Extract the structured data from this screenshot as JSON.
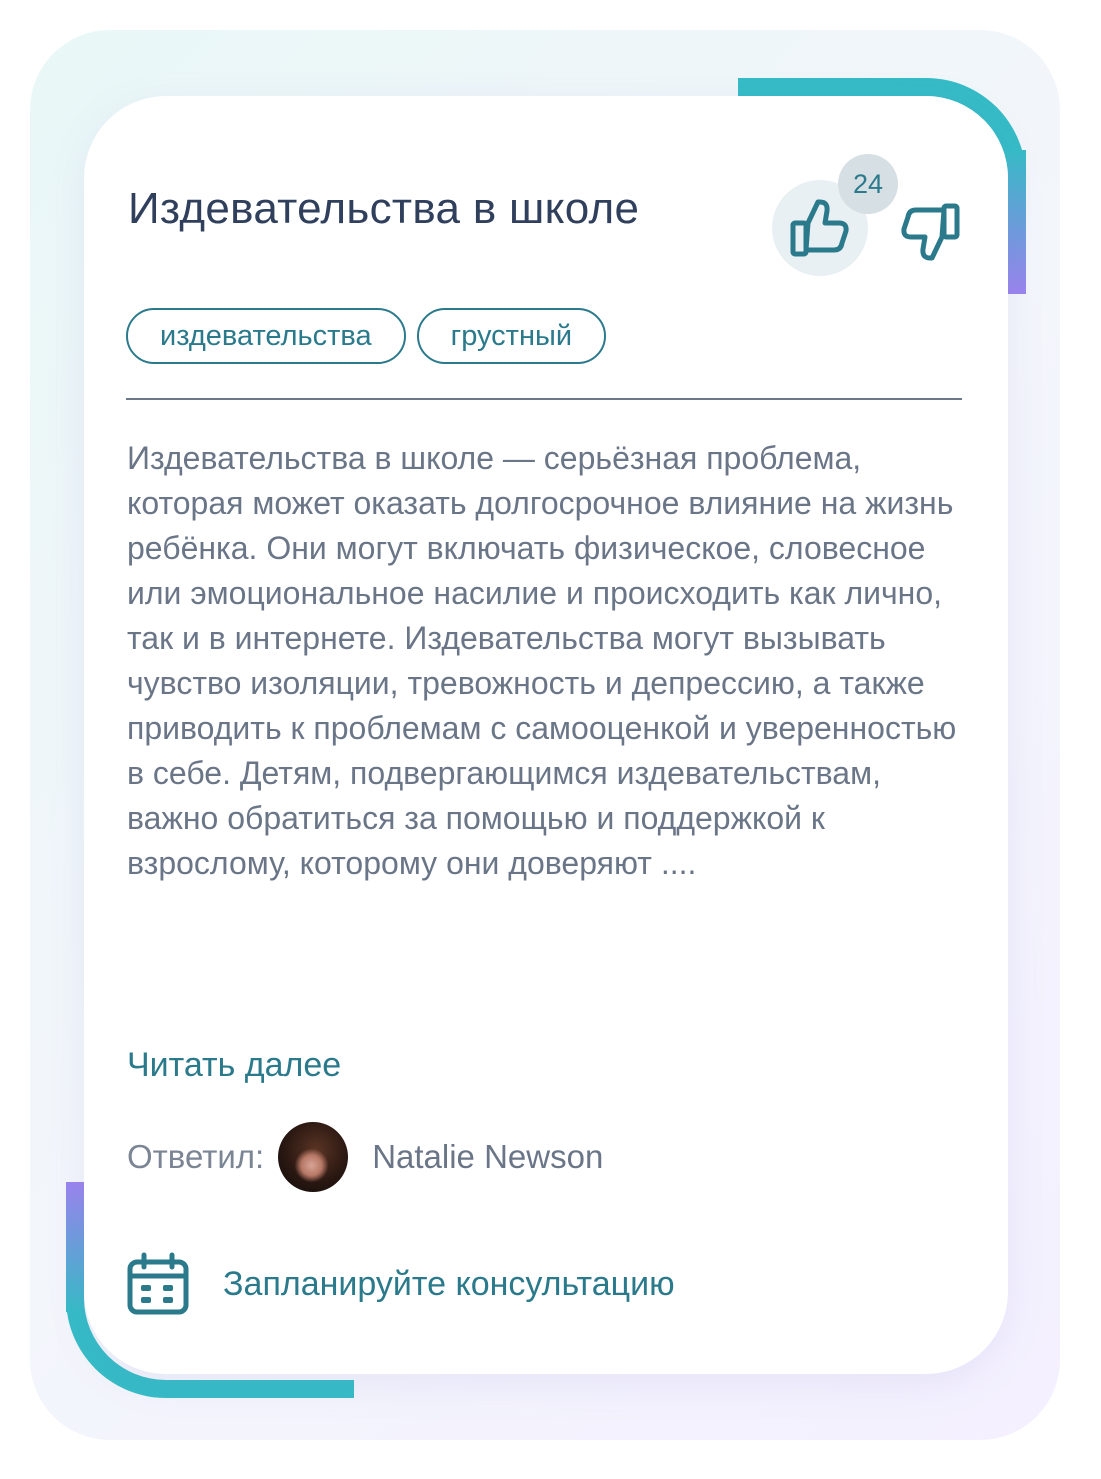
{
  "card": {
    "title": "Издевательства в школе",
    "likes_count": "24",
    "tags": [
      "издевательства",
      "грустный"
    ],
    "body": "Издевательства в школе — серьёзная проблема, которая может оказать долгосрочное влияние на жизнь ребёнка. Они могут включать физическое, словесное или эмоциональное насилие и происходить как лично, так и в интернете. Издевательства могут вызывать чувство изоляции, тревожность и депрессию, а также приводить к проблемам с самооценкой и уверенностью в себе. Детям, подвергающимся издевательствам, важно обратиться за помощью и поддержкой к взрослому, которому они доверяют ....",
    "read_more": "Читать далее",
    "answered_label": "Ответил:",
    "answered_name": "Natalie Newson",
    "schedule_label": "Запланируйте консультацию"
  },
  "icons": {
    "like": "thumbs-up-icon",
    "dislike": "thumbs-down-icon",
    "calendar": "calendar-icon"
  },
  "colors": {
    "accent": "#2b7a8c",
    "title": "#2f3f5c",
    "body": "#6a7687",
    "gradient_teal": "#35bcc6",
    "gradient_purple": "#9b84ee"
  }
}
